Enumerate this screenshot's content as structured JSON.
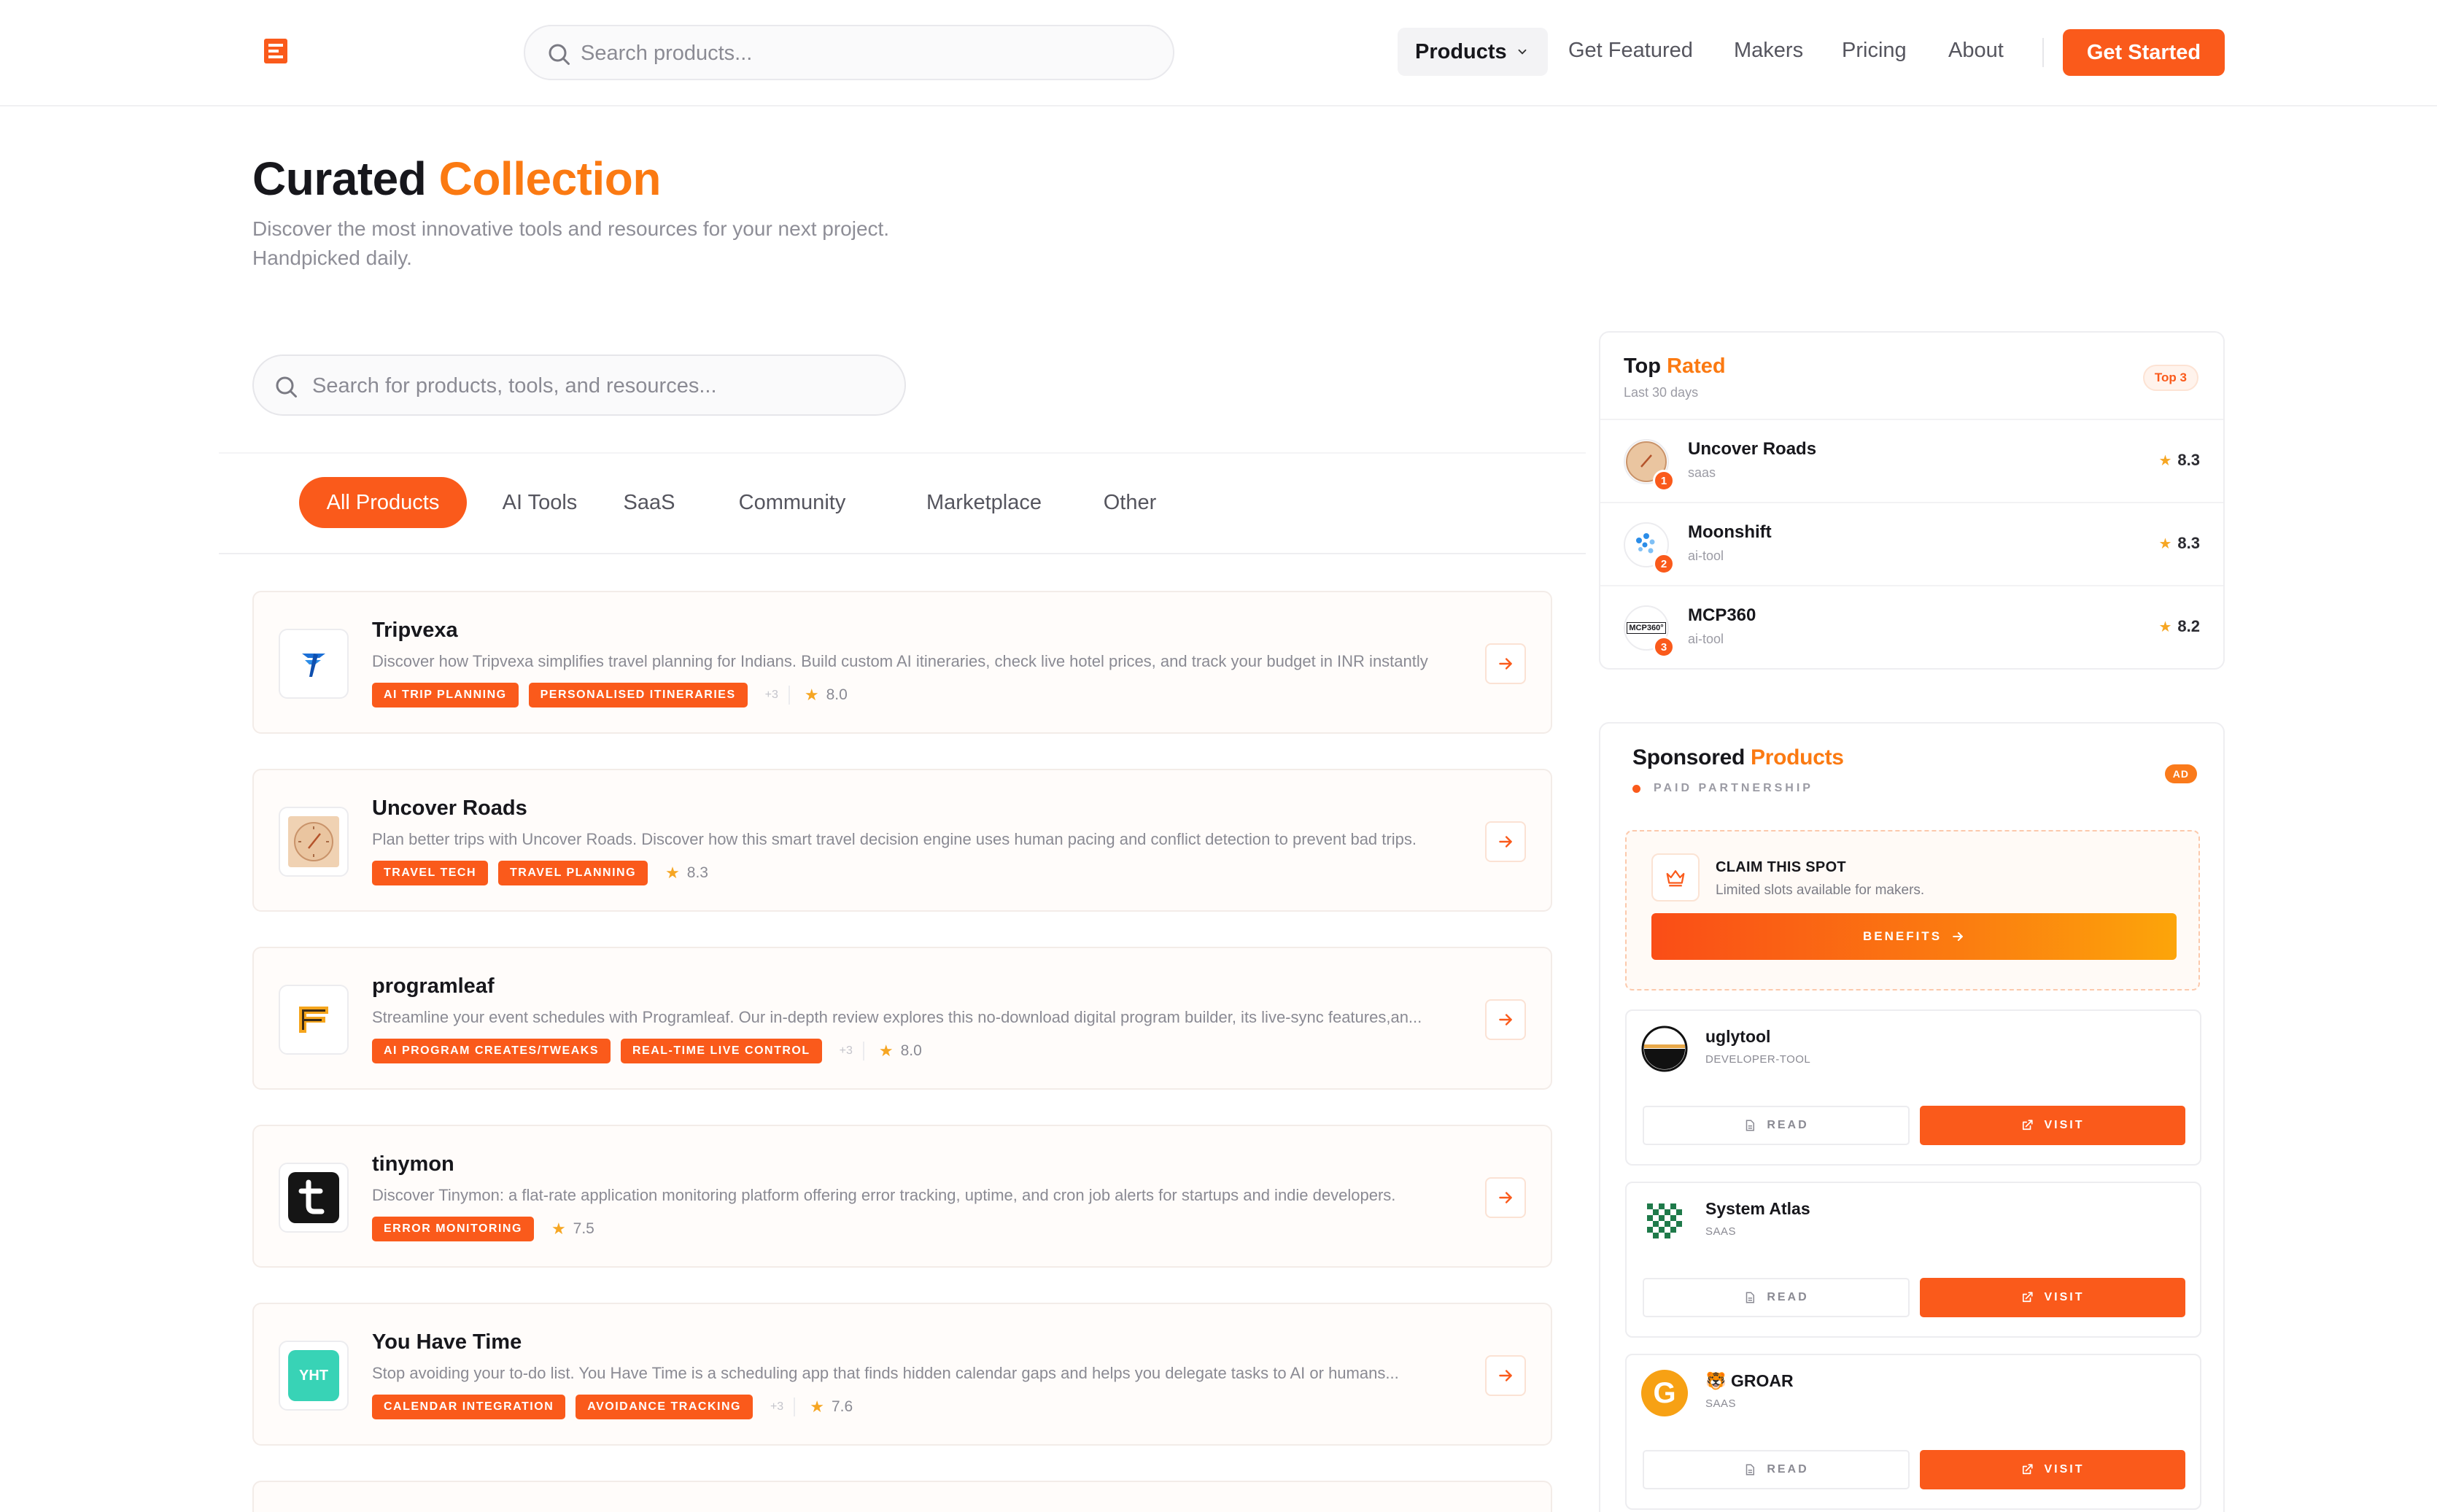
{
  "nav": {
    "search_placeholder": "Search products...",
    "products_label": "Products",
    "links": [
      "Get Featured",
      "Makers",
      "Pricing",
      "About"
    ],
    "cta_label": "Get Started"
  },
  "hero": {
    "title_main": "Curated",
    "title_accent": "Collection",
    "subtitle_line1": "Discover the most innovative tools and resources for your next project.",
    "subtitle_line2": "Handpicked daily."
  },
  "main_search": {
    "placeholder": "Search for products, tools, and resources..."
  },
  "tabs": [
    "All Products",
    "AI Tools",
    "SaaS",
    "Community",
    "Marketplace",
    "Other"
  ],
  "products": [
    {
      "name": "Tripvexa",
      "description": "Discover how Tripvexa simplifies travel planning for Indians. Build custom AI itineraries, check live hotel prices, and track your budget in INR instantly",
      "tags": [
        "AI TRIP PLANNING",
        "PERSONALISED ITINERARIES"
      ],
      "more": "+3",
      "rating": "8.0",
      "logo_icon": "tripvexa-logo-icon"
    },
    {
      "name": "Uncover Roads",
      "description": "Plan better trips with Uncover Roads. Discover how this smart travel decision engine uses human pacing and conflict detection to prevent bad trips.",
      "tags": [
        "TRAVEL TECH",
        "TRAVEL PLANNING"
      ],
      "more": "",
      "rating": "8.3",
      "logo_icon": "compass-logo-icon"
    },
    {
      "name": "programleaf",
      "description": "Streamline your event schedules with Programleaf. Our in-depth review explores this no-download digital program builder, its live-sync features,an...",
      "tags": [
        "AI PROGRAM CREATES/TWEAKS",
        "REAL-TIME LIVE CONTROL"
      ],
      "more": "+3",
      "rating": "8.0",
      "logo_icon": "programleaf-logo-icon"
    },
    {
      "name": "tinymon",
      "description": "Discover Tinymon: a flat-rate application monitoring platform offering error tracking, uptime, and cron job alerts for startups and indie developers.",
      "tags": [
        "ERROR MONITORING"
      ],
      "more": "",
      "rating": "7.5",
      "logo_icon": "tinymon-logo-icon"
    },
    {
      "name": "You Have Time",
      "description": "Stop avoiding your to-do list. You Have Time is a scheduling app that finds hidden calendar gaps and helps you delegate tasks to AI or humans...",
      "tags": [
        "CALENDAR INTEGRATION",
        "AVOIDANCE TRACKING"
      ],
      "more": "+3",
      "rating": "7.6",
      "logo_text": "YHT"
    }
  ],
  "top_rated": {
    "title_main": "Top",
    "title_accent": "Rated",
    "subtitle": "Last 30 days",
    "badge": "Top 3",
    "items": [
      {
        "rank": "1",
        "name": "Uncover Roads",
        "category": "saas",
        "score": "8.3"
      },
      {
        "rank": "2",
        "name": "Moonshift",
        "category": "ai-tool",
        "score": "8.3"
      },
      {
        "rank": "3",
        "name": "MCP360",
        "category": "ai-tool",
        "score": "8.2",
        "logo_text": "MCP360°"
      }
    ]
  },
  "sponsored": {
    "title_main": "Sponsored",
    "title_accent": "Products",
    "subtitle": "PAID PARTNERSHIP",
    "ad_badge": "AD",
    "claim": {
      "title": "CLAIM THIS SPOT",
      "subtitle": "Limited slots available for makers.",
      "button": "BENEFITS"
    },
    "items": [
      {
        "name": "uglytool",
        "category": "DEVELOPER-TOOL",
        "read": "READ",
        "visit": "VISIT"
      },
      {
        "name": "System Atlas",
        "category": "SAAS",
        "read": "READ",
        "visit": "VISIT"
      },
      {
        "name": "🐯 GROAR",
        "category": "SAAS",
        "read": "READ",
        "visit": "VISIT",
        "logo_text": "G"
      }
    ]
  },
  "colors": {
    "accent": "#fa5a1b",
    "accent_text": "#fb7a12",
    "star": "#f6a623"
  }
}
